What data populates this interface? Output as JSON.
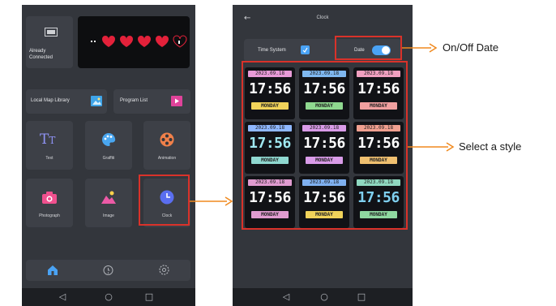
{
  "left_screen": {
    "status_tile": {
      "label_line1": "Already",
      "label_line2": "Connected"
    },
    "buttons": {
      "local_map_library": "Local Map Library",
      "program_list": "Program List"
    },
    "tiles": [
      {
        "label": "Text",
        "icon": "text-icon"
      },
      {
        "label": "Graffiti",
        "icon": "palette-icon"
      },
      {
        "label": "Animation",
        "icon": "film-reel-icon"
      },
      {
        "label": "Photograph",
        "icon": "camera-icon"
      },
      {
        "label": "Image",
        "icon": "image-icon"
      },
      {
        "label": "Clock",
        "icon": "clock-icon"
      }
    ],
    "bottom_nav": [
      "home-icon",
      "timer-icon",
      "settings-icon"
    ]
  },
  "right_screen": {
    "title": "Clock",
    "time_system_label": "Time System",
    "date_label": "Date",
    "date_toggle_on": true,
    "clock_styles": [
      {
        "date": "2023.09.18",
        "time": "17:56",
        "day": "MONDAY",
        "date_color": "#e89bd8",
        "time_color": "#ffffff",
        "day_color": "#f1d35a"
      },
      {
        "date": "2023.09.18",
        "time": "17:56",
        "day": "MONDAY",
        "date_color": "#7fb8f0",
        "time_color": "#ffffff",
        "day_color": "#8fd88f"
      },
      {
        "date": "2023.09.18",
        "time": "17:56",
        "day": "MONDAY",
        "date_color": "#f0a0c0",
        "time_color": "#ffffff",
        "day_color": "#f0a0a0"
      },
      {
        "date": "2023.09.18",
        "time": "17:56",
        "day": "MONDAY",
        "date_color": "#8fb8ff",
        "time_color": "#9fe8f0",
        "day_color": "#8fd8d0"
      },
      {
        "date": "2023.09.18",
        "time": "17:56",
        "day": "MONDAY",
        "date_color": "#d99be8",
        "time_color": "#ffffff",
        "day_color": "#d99be8"
      },
      {
        "date": "2023.09.18",
        "time": "17:56",
        "day": "MONDAY",
        "date_color": "#f0a090",
        "time_color": "#ffffff",
        "day_color": "#f0c070"
      },
      {
        "date": "2023.09.18",
        "time": "17:56",
        "day": "MONDAY",
        "date_color": "#e09bd0",
        "time_color": "#ffffff",
        "day_color": "#e09bd0"
      },
      {
        "date": "2023.09.18",
        "time": "17:56",
        "day": "MONDAY",
        "date_color": "#7fb0f0",
        "time_color": "#ffffff",
        "day_color": "#f1d35a"
      },
      {
        "date": "2023.09.18",
        "time": "17:56",
        "day": "MONDAY",
        "date_color": "#8fd8c0",
        "time_color": "#7fd0f0",
        "day_color": "#8fd8a0"
      }
    ]
  },
  "annotations": {
    "on_off_date": "On/Off Date",
    "select_style": "Select a style"
  },
  "colors": {
    "highlight": "#d9322a",
    "arrow": "#f0891e",
    "toggle": "#4aa3f5",
    "phone_bg": "#33363c"
  }
}
